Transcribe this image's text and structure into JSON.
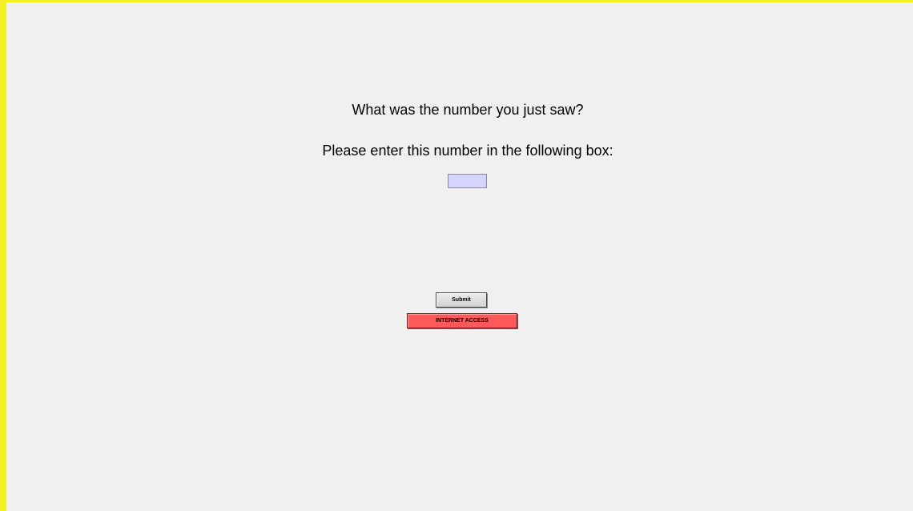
{
  "prompt": {
    "question": "What was the number you just saw?",
    "instruction": "Please enter this number in the following box:"
  },
  "answer_input": {
    "value": ""
  },
  "buttons": {
    "submit_label": "Submit",
    "internet_label": "INTERNET ACCESS"
  },
  "colors": {
    "frame_border": "#f5f023",
    "background": "#f0f0f0",
    "input_fill": "#d4d4ff",
    "internet_button": "#ff5a5a"
  }
}
